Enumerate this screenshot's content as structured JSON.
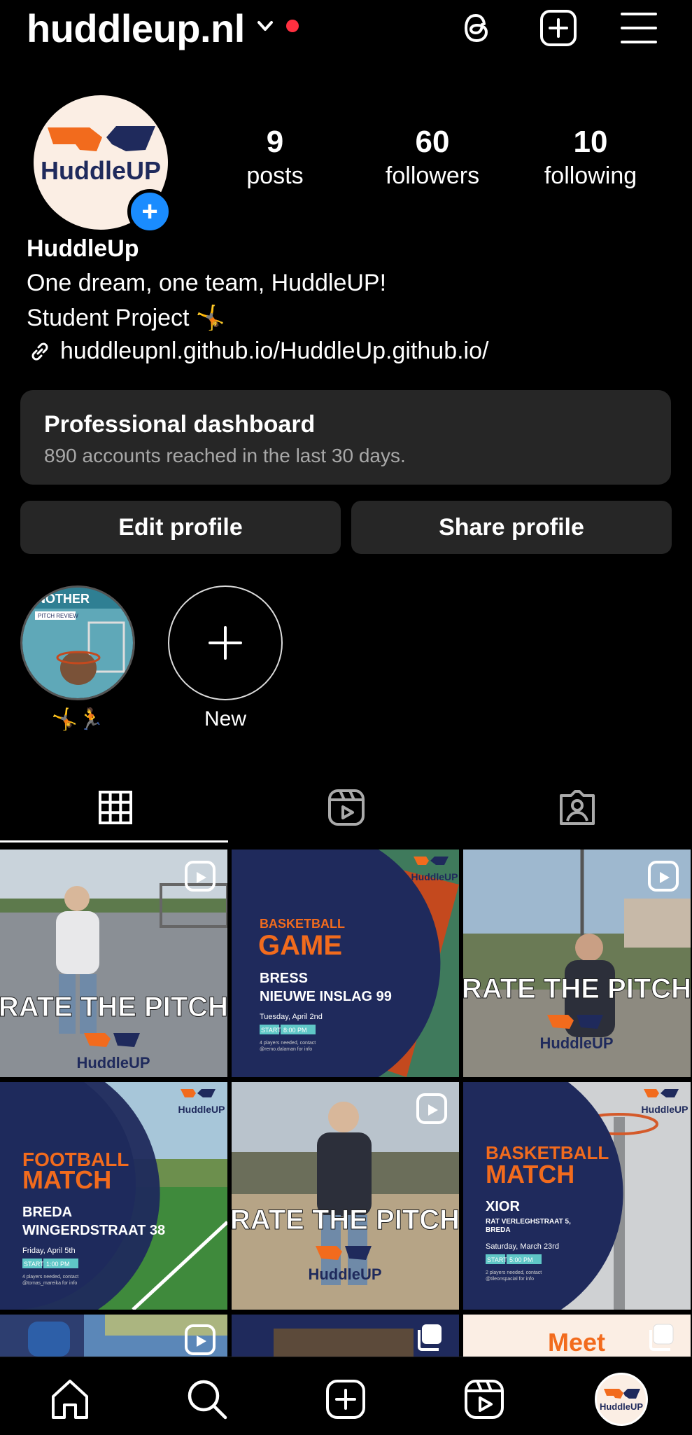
{
  "header": {
    "username": "huddleup.nl",
    "icons": [
      "chevron-down-icon",
      "notification-dot",
      "threads-icon",
      "create-icon",
      "menu-icon"
    ]
  },
  "profile": {
    "avatar_text": "HuddleUP",
    "stats": [
      {
        "value": "9",
        "label": "posts"
      },
      {
        "value": "60",
        "label": "followers"
      },
      {
        "value": "10",
        "label": "following"
      }
    ],
    "name": "HuddleUp",
    "bio_line1": "One dream, one team, HuddleUP!",
    "bio_line2": "Student Project 🤸",
    "link": "huddleupnl.github.io/HuddleUp.github.io/"
  },
  "dashboard": {
    "title": "Professional dashboard",
    "subtitle": "890 accounts reached in the last 30 days."
  },
  "buttons": {
    "edit": "Edit profile",
    "share": "Share profile"
  },
  "highlights": [
    {
      "label": "🤸🏃",
      "cover_text_1": "NOTHER",
      "cover_text_2": "PITCH REVIEW"
    },
    {
      "label": "New"
    }
  ],
  "tabs": [
    "grid-icon",
    "reels-icon",
    "tagged-icon"
  ],
  "posts": [
    {
      "type": "reel",
      "overlay": "RATE THE PITCH",
      "brand": "HuddleUP"
    },
    {
      "type": "post",
      "brand": "HuddleUP",
      "kind": "BASKETBALL",
      "headline": "GAME",
      "place1": "BRESS",
      "place2": "NIEUWE INSLAG 99",
      "date": "Tuesday, April 2nd",
      "start_label": "START",
      "time": "8:00 PM",
      "note1": "4 players needed, contact",
      "note2": "@remo.dalaman for info"
    },
    {
      "type": "reel",
      "overlay": "RATE THE PITCH",
      "brand": "HuddleUP"
    },
    {
      "type": "post",
      "brand": "HuddleUP",
      "kind": "FOOTBALL",
      "headline": "MATCH",
      "place1": "BREDA",
      "place2": "WINGERDSTRAAT 38",
      "date": "Friday, April 5th",
      "start_label": "START",
      "time": "1:00 PM",
      "note1": "4 players needed, contact",
      "note2": "@tomas_mareika for info"
    },
    {
      "type": "reel",
      "overlay": "RATE THE PITCH",
      "brand": "HuddleUP"
    },
    {
      "type": "post",
      "brand": "HuddleUP",
      "kind": "BASKETBALL",
      "headline": "MATCH",
      "place1": "XIOR",
      "place2": "RAT VERLEGHSTRAAT 5,",
      "place3": "BREDA",
      "date": "Saturday, March 23rd",
      "start_label": "START",
      "time": "5:00 PM",
      "note1": "2 players needed, contact",
      "note2": "@tileonspacial for info"
    },
    {
      "type": "reel"
    },
    {
      "type": "carousel"
    },
    {
      "type": "carousel",
      "headline": "Meet"
    }
  ],
  "nav": [
    "home-icon",
    "search-icon",
    "create-icon",
    "reels-icon",
    "profile-avatar"
  ],
  "colors": {
    "accent_blue": "#1a8cff",
    "brand_orange": "#f26b1d",
    "brand_navy": "#1f2a5c",
    "surface": "#262626",
    "notification": "#ff3040"
  }
}
